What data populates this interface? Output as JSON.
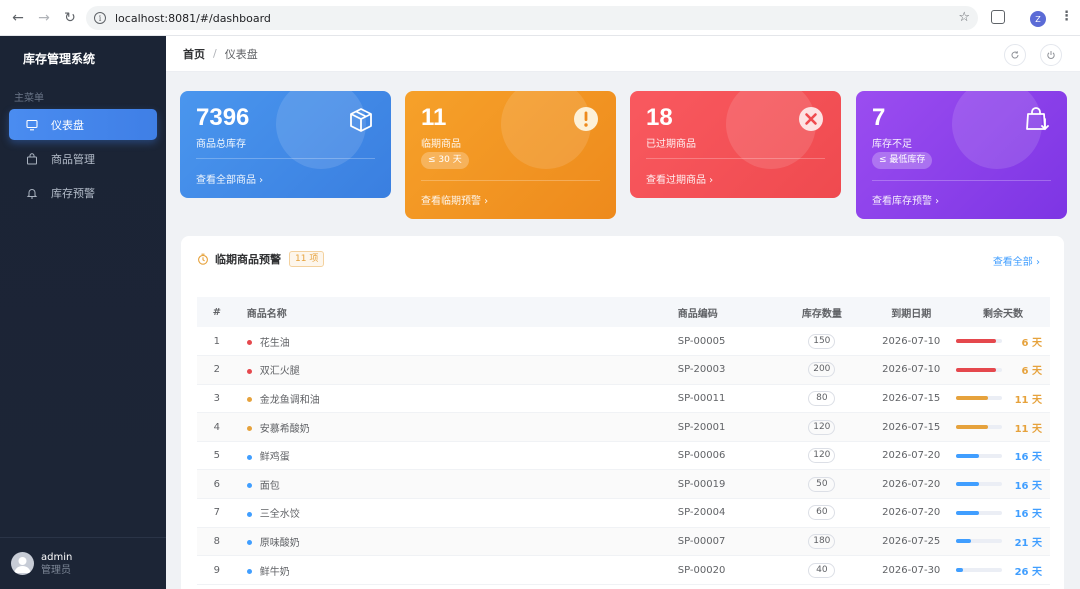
{
  "browser": {
    "url": "localhost:8081/#/dashboard",
    "profile_initial": "Z"
  },
  "sidebar": {
    "app_title": "库存管理系统",
    "group_label": "主菜单",
    "items": [
      {
        "label": "仪表盘",
        "icon": "monitor-icon",
        "active": true
      },
      {
        "label": "商品管理",
        "icon": "shopping-bag-icon",
        "active": false
      },
      {
        "label": "库存预警",
        "icon": "bell-icon",
        "active": false
      }
    ],
    "user": {
      "name": "admin",
      "role": "管理员"
    }
  },
  "header": {
    "breadcrumb_home": "首页",
    "breadcrumb_sep": "/",
    "breadcrumb_current": "仪表盘"
  },
  "cards": [
    {
      "value": "7396",
      "label": "商品总库存",
      "tag": "",
      "link": "查看全部商品 ›",
      "icon": "box-icon",
      "color_from": "#4a96ee",
      "color_to": "#3a7fe0"
    },
    {
      "value": "11",
      "label": "临期商品",
      "tag": "≤ 30 天",
      "link": "查看临期预警 ›",
      "icon": "warning-circle-icon",
      "color_from": "#f6a12a",
      "color_to": "#ee8a1c"
    },
    {
      "value": "18",
      "label": "已过期商品",
      "tag": "",
      "link": "查看过期商品 ›",
      "icon": "close-circle-icon",
      "color_from": "#f9595f",
      "color_to": "#ef4a4f"
    },
    {
      "value": "7",
      "label": "库存不足",
      "tag": "≤ 最低库存",
      "link": "查看库存预警 ›",
      "icon": "bag-download-icon",
      "color_from": "#9b4df0",
      "color_to": "#7d35e4"
    }
  ],
  "expiring": {
    "title": "临期商品预警",
    "count": "11 项",
    "view_all": "查看全部 ›",
    "columns": [
      "#",
      "商品名称",
      "商品编码",
      "库存数量",
      "到期日期",
      "剩余天数"
    ],
    "rows": [
      {
        "idx": "1",
        "name": "花生油",
        "code": "SP-00005",
        "qty": "150",
        "date": "2026-07-10",
        "days": "6 天",
        "level": 0.87,
        "color": "#e5484d"
      },
      {
        "idx": "2",
        "name": "双汇火腿",
        "code": "SP-20003",
        "qty": "200",
        "date": "2026-07-10",
        "days": "6 天",
        "level": 0.87,
        "color": "#e5484d"
      },
      {
        "idx": "3",
        "name": "金龙鱼调和油",
        "code": "SP-00011",
        "qty": "80",
        "date": "2026-07-15",
        "days": "11 天",
        "level": 0.7,
        "color": "#e6a23c"
      },
      {
        "idx": "4",
        "name": "安慕希酸奶",
        "code": "SP-20001",
        "qty": "120",
        "date": "2026-07-15",
        "days": "11 天",
        "level": 0.7,
        "color": "#e6a23c"
      },
      {
        "idx": "5",
        "name": "鲜鸡蛋",
        "code": "SP-00006",
        "qty": "120",
        "date": "2026-07-20",
        "days": "16 天",
        "level": 0.5,
        "color": "#409eff"
      },
      {
        "idx": "6",
        "name": "面包",
        "code": "SP-00019",
        "qty": "50",
        "date": "2026-07-20",
        "days": "16 天",
        "level": 0.5,
        "color": "#409eff"
      },
      {
        "idx": "7",
        "name": "三全水饺",
        "code": "SP-20004",
        "qty": "60",
        "date": "2026-07-20",
        "days": "16 天",
        "level": 0.5,
        "color": "#409eff"
      },
      {
        "idx": "8",
        "name": "原味酸奶",
        "code": "SP-00007",
        "qty": "180",
        "date": "2026-07-25",
        "days": "21 天",
        "level": 0.32,
        "color": "#409eff"
      },
      {
        "idx": "9",
        "name": "鲜牛奶",
        "code": "SP-00020",
        "qty": "40",
        "date": "2026-07-30",
        "days": "26 天",
        "level": 0.15,
        "color": "#409eff"
      }
    ]
  }
}
